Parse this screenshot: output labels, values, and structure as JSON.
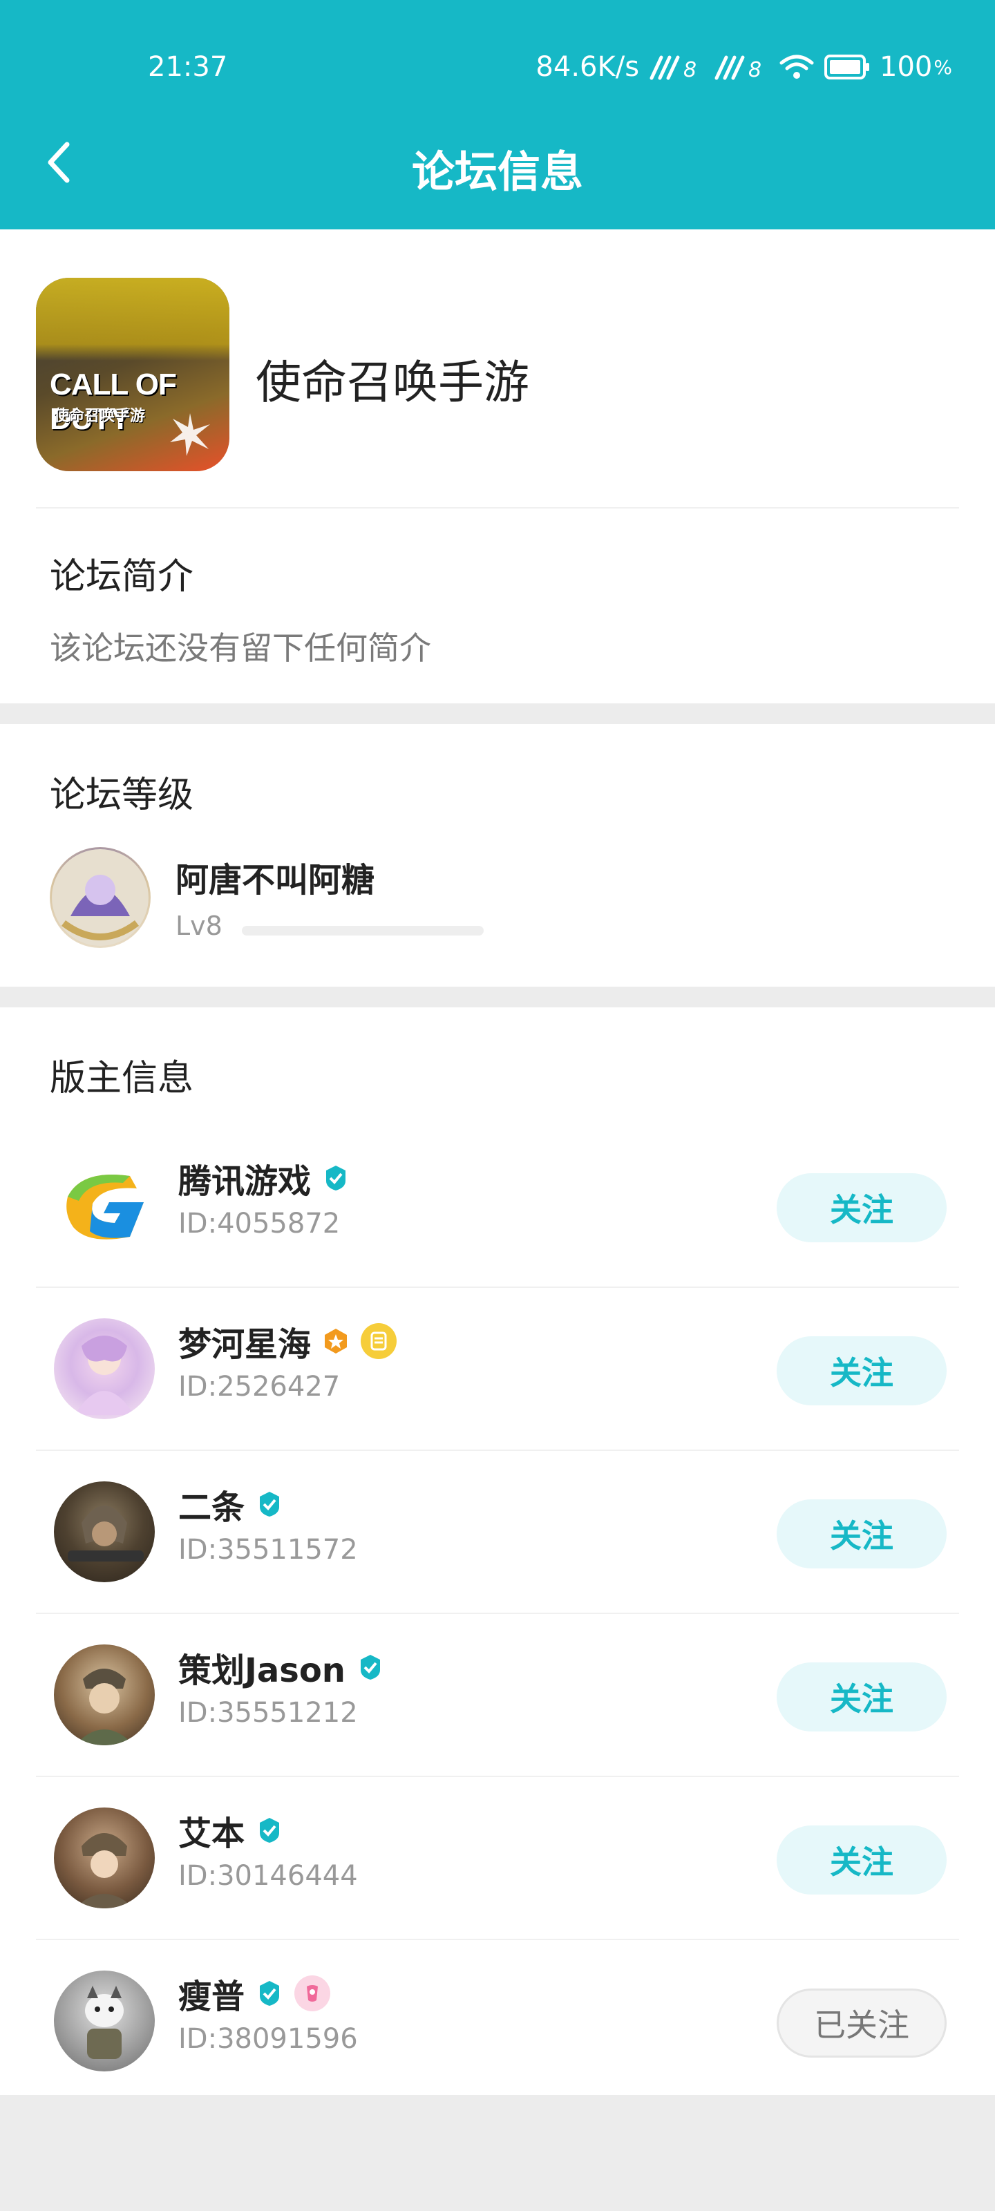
{
  "status_bar": {
    "time": "21:37",
    "network_speed": "84.6K/s",
    "battery": "100"
  },
  "header": {
    "title": "论坛信息",
    "back_icon": "chevron-left-icon"
  },
  "forum": {
    "name": "使命召唤手游",
    "icon_text": "CALL OF DUTY",
    "icon_subtext": "使命召唤手游"
  },
  "intro": {
    "title": "论坛简介",
    "text": "该论坛还没有留下任何简介"
  },
  "level": {
    "title": "论坛等级",
    "user_name": "阿唐不叫阿糖",
    "level_label": "Lv8",
    "progress_fraction": 0.0
  },
  "moderators": {
    "title": "版主信息",
    "items": [
      {
        "name": "腾讯游戏",
        "id": "ID:4055872",
        "button": "关注",
        "followed": false,
        "badges": [
          "verified-icon"
        ]
      },
      {
        "name": "梦河星海",
        "id": "ID:2526427",
        "button": "关注",
        "followed": false,
        "badges": [
          "star-badge-icon",
          "medal-icon"
        ]
      },
      {
        "name": "二条",
        "id": "ID:35511572",
        "button": "关注",
        "followed": false,
        "badges": [
          "verified-icon"
        ]
      },
      {
        "name": "策划Jason",
        "id": "ID:35551212",
        "button": "关注",
        "followed": false,
        "badges": [
          "verified-icon"
        ]
      },
      {
        "name": "艾本",
        "id": "ID:30146444",
        "button": "关注",
        "followed": false,
        "badges": [
          "verified-icon"
        ]
      },
      {
        "name": "瘦普",
        "id": "ID:38091596",
        "button": "已关注",
        "followed": true,
        "badges": [
          "verified-icon",
          "pink-badge-icon"
        ]
      }
    ]
  },
  "colors": {
    "accent": "#16b8c6",
    "follow_bg": "#e6f8fa",
    "page_bg": "#ececec"
  }
}
